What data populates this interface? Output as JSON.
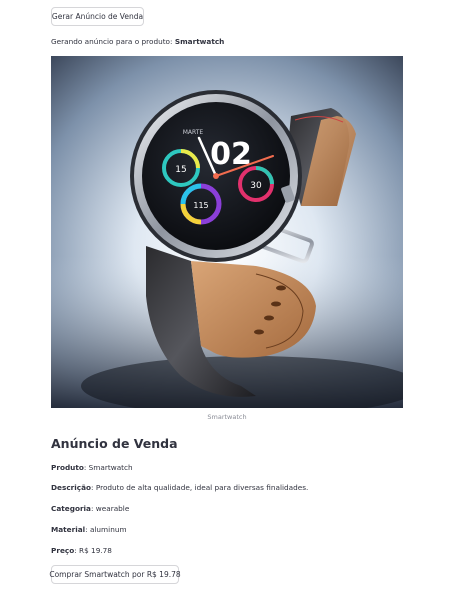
{
  "buttons": {
    "generate_label": "Gerar Anúncio de Venda",
    "buy_label": "Comprar Smartwatch por R$ 19.78"
  },
  "status": {
    "prefix": "Gerando anúncio para o produto:",
    "product": "Smartwatch"
  },
  "image": {
    "caption": "Smartwatch",
    "watch_face": {
      "time": "02",
      "left_dial": "15",
      "right_dial": "30",
      "bottom_dial": "115",
      "top_text": "MARTE"
    }
  },
  "listing": {
    "heading": "Anúncio de Venda",
    "fields": [
      {
        "label": "Produto",
        "value": "Smartwatch"
      },
      {
        "label": "Descrição",
        "value": "Produto de alta qualidade, ideal para diversas finalidades."
      },
      {
        "label": "Categoria",
        "value": "wearable"
      },
      {
        "label": "Material",
        "value": "aluminum"
      },
      {
        "label": "Preço",
        "value": "R$ 19.78"
      }
    ]
  }
}
